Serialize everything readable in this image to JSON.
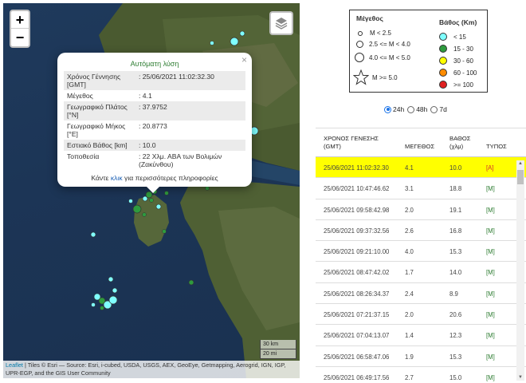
{
  "map": {
    "zoom_in": "+",
    "zoom_out": "−",
    "close": "×",
    "scale_km": "30 km",
    "scale_mi": "20 mi",
    "attribution_link": "Leaflet",
    "attribution_text": " | Tiles © Esri — Source: Esri, i-cubed, USDA, USGS, AEX, GeoEye, Getmapping, Aerogrid, IGN, IGP, UPR-EGP, and the GIS User Community"
  },
  "popup": {
    "title": "Αυτόματη λύση",
    "rows": [
      {
        "label": "Χρόνος Γέννησης [GMT]",
        "value": ": 25/06/2021 11:02:32.30"
      },
      {
        "label": "Μέγεθος",
        "value": ": 4.1"
      },
      {
        "label": "Γεωγραφικό Πλάτος [°N]",
        "value": ": 37.9752"
      },
      {
        "label": "Γεωγραφικό Μήκος [°E]",
        "value": ": 20.8773"
      },
      {
        "label": "Εστιακό Βάθος [km]",
        "value": ": 10.0"
      },
      {
        "label": "Τοποθεσία",
        "value": ": 22 Χλμ. ΑΒΑ των Βολιμών (Ζακύνθου)"
      }
    ],
    "footer_pre": "Κάντε ",
    "footer_link": "κλικ",
    "footer_post": " για περισσότερες πληροφορίες"
  },
  "legend": {
    "mag_title": "Μέγεθος",
    "mag_items": [
      "M < 2.5",
      "2.5 <= M < 4.0",
      "4.0 <= M < 5.0",
      "M >= 5.0"
    ],
    "depth_title": "Βάθος (Km)",
    "depth_items": [
      {
        "label": "< 15",
        "color": "#7fffff"
      },
      {
        "label": "15 - 30",
        "color": "#2e9b3e"
      },
      {
        "label": "30 - 60",
        "color": "#ffff00"
      },
      {
        "label": "60 - 100",
        "color": "#ff8c00"
      },
      {
        "label": ">= 100",
        "color": "#e02020"
      }
    ]
  },
  "period": {
    "options": [
      "24h",
      "48h",
      "7d"
    ],
    "selected": "24h"
  },
  "table": {
    "headers": {
      "time": [
        "ΧΡΟΝΟΣ ΓΕΝΕΣΗΣ",
        "(GMT)"
      ],
      "mag": "ΜΕΓΕΘΟΣ",
      "depth": [
        "ΒΑΘΟΣ",
        "(χλμ)"
      ],
      "type": "ΤΥΠΟΣ"
    },
    "rows": [
      {
        "time": "25/06/2021 11:02:32.30",
        "mag": "4.1",
        "depth": "10.0",
        "type": "[A]"
      },
      {
        "time": "25/06/2021 10:47:46.62",
        "mag": "3.1",
        "depth": "18.8",
        "type": "[M]"
      },
      {
        "time": "25/06/2021 09:58:42.98",
        "mag": "2.0",
        "depth": "19.1",
        "type": "[M]"
      },
      {
        "time": "25/06/2021 09:37:32.56",
        "mag": "2.6",
        "depth": "16.8",
        "type": "[M]"
      },
      {
        "time": "25/06/2021 09:21:10.00",
        "mag": "4.0",
        "depth": "15.3",
        "type": "[M]"
      },
      {
        "time": "25/06/2021 08:47:42.02",
        "mag": "1.7",
        "depth": "14.0",
        "type": "[M]"
      },
      {
        "time": "25/06/2021 08:26:34.37",
        "mag": "2.4",
        "depth": "8.9",
        "type": "[M]"
      },
      {
        "time": "25/06/2021 07:21:37.15",
        "mag": "2.0",
        "depth": "20.6",
        "type": "[M]"
      },
      {
        "time": "25/06/2021 07:04:13.07",
        "mag": "1.4",
        "depth": "12.3",
        "type": "[M]"
      },
      {
        "time": "25/06/2021 06:58:47.06",
        "mag": "1.9",
        "depth": "15.3",
        "type": "[M]"
      },
      {
        "time": "25/06/2021 06:49:17.56",
        "mag": "2.7",
        "depth": "15.0",
        "type": "[M]"
      }
    ]
  }
}
